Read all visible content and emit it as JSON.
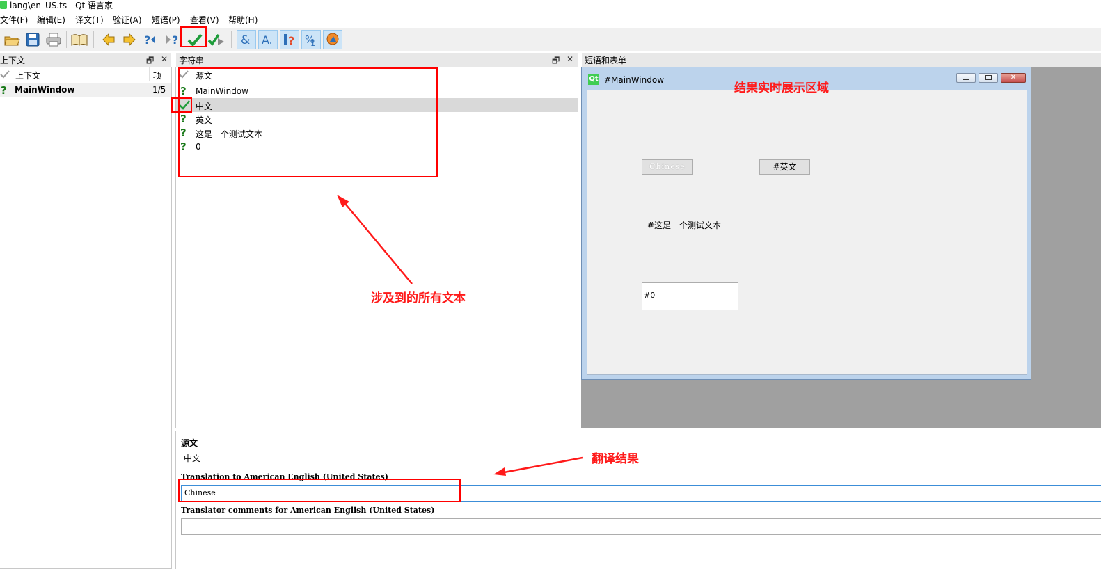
{
  "window": {
    "title": "lang\\en_US.ts - Qt 语言家"
  },
  "menu": [
    "文件(F)",
    "编辑(E)",
    "译文(T)",
    "验证(A)",
    "短语(P)",
    "查看(V)",
    "帮助(H)"
  ],
  "toolbar": {
    "icons": [
      "open-icon",
      "save-icon",
      "print-icon",
      "phrasebook-icon",
      "prev-icon",
      "next-icon",
      "prev-unfinished-icon",
      "next-unfinished-icon",
      "done-next-icon",
      "done-icon",
      "accelerators-icon",
      "ending-punctuation-icon",
      "phrase-matches-icon",
      "place-markers-icon",
      "surrounding-whitespace-icon"
    ]
  },
  "context_dock": {
    "title": "上下文",
    "float_glyph": "🗗",
    "close_glyph": "✕",
    "header": {
      "context": "上下文",
      "items": "项"
    },
    "rows": [
      {
        "name": "MainWindow",
        "count": "1/5"
      }
    ]
  },
  "strings_dock": {
    "title": "字符串",
    "float_glyph": "🗗",
    "close_glyph": "✕",
    "header": "源文",
    "rows": [
      {
        "text": "MainWindow",
        "status": "unfinished"
      },
      {
        "text": "中文",
        "status": "done"
      },
      {
        "text": "英文",
        "status": "unfinished"
      },
      {
        "text": "这是一个测试文本",
        "status": "unfinished"
      },
      {
        "text": "0",
        "status": "unfinished"
      }
    ]
  },
  "phrases_dock": {
    "title": "短语和表单",
    "form": {
      "title": "#MainWindow",
      "qt_logo": "Qt",
      "button1": "Chinese",
      "button2": "#英文",
      "label": "#这是一个测试文本",
      "field": "#0"
    }
  },
  "editor": {
    "source_label": "源文",
    "source_text": "中文",
    "translation_label": "Translation to American English (United States)",
    "translation_value": "Chinese",
    "comments_label": "Translator comments for American English (United States)",
    "comments_value": ""
  },
  "annotations": {
    "all_text": "涉及到的所有文本",
    "preview": "结果实时展示区域",
    "result": "翻译结果"
  },
  "colors": {
    "annotation": "#ff1a1a",
    "selected_row": "#d9d9d9",
    "mdi_bg": "#a0a0a0"
  }
}
